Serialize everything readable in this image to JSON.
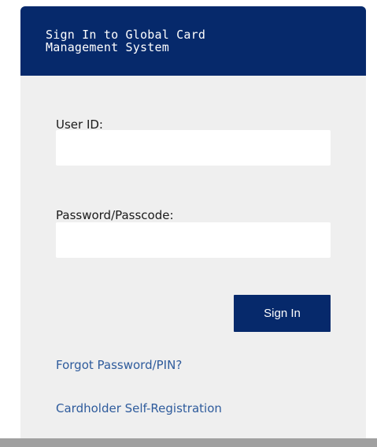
{
  "header": {
    "title": "Sign In to Global Card\nManagement System"
  },
  "form": {
    "user_id": {
      "label": "User ID:",
      "value": ""
    },
    "password": {
      "label": "Password/Passcode:",
      "value": ""
    },
    "submit_label": "Sign In"
  },
  "links": {
    "forgot": "Forgot Password/PIN?",
    "self_registration": "Cardholder Self-Registration"
  },
  "colors": {
    "brand_navy": "#06296b",
    "panel_background": "#efefef",
    "link_blue": "#2e5b9c",
    "footer_bar": "#a0a0a0"
  }
}
